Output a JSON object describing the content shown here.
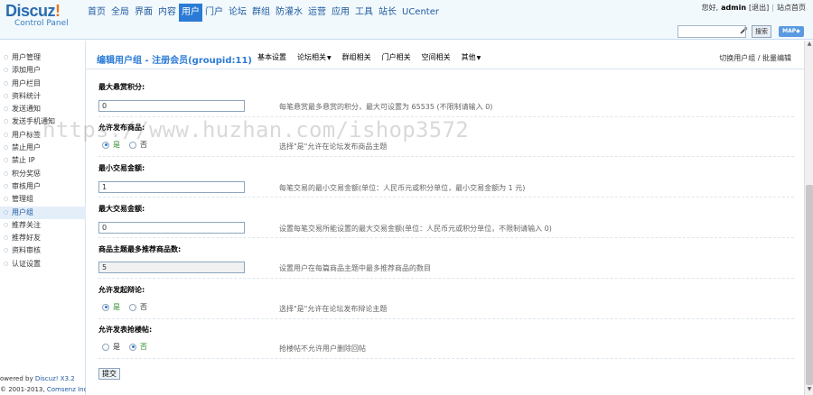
{
  "header": {
    "logo_brand": "Discuz",
    "logo_bang": "!",
    "logo_sub": "Control Panel",
    "nav": [
      {
        "label": "首页",
        "active": false
      },
      {
        "label": "全局",
        "active": false
      },
      {
        "label": "界面",
        "active": false
      },
      {
        "label": "内容",
        "active": false
      },
      {
        "label": "用户",
        "active": true
      },
      {
        "label": "门户",
        "active": false
      },
      {
        "label": "论坛",
        "active": false
      },
      {
        "label": "群组",
        "active": false
      },
      {
        "label": "防灌水",
        "active": false
      },
      {
        "label": "运营",
        "active": false
      },
      {
        "label": "应用",
        "active": false
      },
      {
        "label": "工具",
        "active": false
      },
      {
        "label": "站长",
        "active": false
      },
      {
        "label": "UCenter",
        "active": false
      }
    ],
    "welcome": "您好,",
    "username": "admin",
    "logout": "[退出]",
    "sep": "|",
    "site_home": "站点首页",
    "search_placeholder": "",
    "search_button": "搜索",
    "map_button": "MAP◆"
  },
  "sidebar": {
    "items": [
      {
        "label": "用户管理",
        "active": false
      },
      {
        "label": "添加用户",
        "active": false
      },
      {
        "label": "用户栏目",
        "active": false
      },
      {
        "label": "资料统计",
        "active": false
      },
      {
        "label": "发送通知",
        "active": false
      },
      {
        "label": "发送手机通知",
        "active": false
      },
      {
        "label": "用户标签",
        "active": false
      },
      {
        "label": "禁止用户",
        "active": false
      },
      {
        "label": "禁止 IP",
        "active": false
      },
      {
        "label": "积分奖惩",
        "active": false
      },
      {
        "label": "审核用户",
        "active": false
      },
      {
        "label": "管理组",
        "active": false
      },
      {
        "label": "用户组",
        "active": true
      },
      {
        "label": "推荐关注",
        "active": false
      },
      {
        "label": "推荐好友",
        "active": false
      },
      {
        "label": "资料审核",
        "active": false
      },
      {
        "label": "认证设置",
        "active": false
      }
    ],
    "powered_prefix": "owered by ",
    "powered_link": "Discuz! X3.2",
    "copyright_prefix": "© 2001-2013, ",
    "copyright_link": "Comsenz Inc."
  },
  "main": {
    "title": "编辑用户组 - 注册会员(groupid:11)",
    "tabs": [
      "基本设置",
      "论坛相关",
      "群组相关",
      "门户相关",
      "空间相关",
      "其他"
    ],
    "tabs_with_caret": [
      false,
      true,
      false,
      false,
      false,
      true
    ],
    "switch_link": "切换用户组 / 批量编辑",
    "fields": {
      "max_reward": {
        "label": "最大悬赏积分:",
        "value": "0",
        "hint": "每笔悬赏最多悬赏的积分，最大可设置为 65535 (不限制请输入 0)"
      },
      "allow_trade": {
        "label": "允许发布商品:",
        "yes": "是",
        "no": "否",
        "selected": "yes",
        "hint": "选择\"是\"允许在论坛发布商品主题"
      },
      "min_trade": {
        "label": "最小交易金额:",
        "value": "1",
        "hint": "每笔交易的最小交易金额(单位：人民币元或积分单位，最小交易金额为 1 元)"
      },
      "max_trade": {
        "label": "最大交易金额:",
        "value": "0",
        "hint": "设置每笔交易所能设置的最大交易金额(单位：人民币元或积分单位，不限制请输入 0)"
      },
      "max_recommend": {
        "label": "商品主题最多推荐商品数:",
        "value": "5",
        "hint": "设置用户在每篇商品主题中最多推荐商品的数目"
      },
      "allow_debate": {
        "label": "允许发起辩论:",
        "yes": "是",
        "no": "否",
        "selected": "yes",
        "hint": "选择\"是\"允许在论坛发布辩论主题"
      },
      "allow_reward_back": {
        "label": "允许发表抢楼帖:",
        "yes": "是",
        "no": "否",
        "selected": "no",
        "hint": "抢楼帖不允许用户删除回帖"
      }
    },
    "submit": "提交"
  },
  "watermark": "https://www.huzhan.com/ishop3572"
}
